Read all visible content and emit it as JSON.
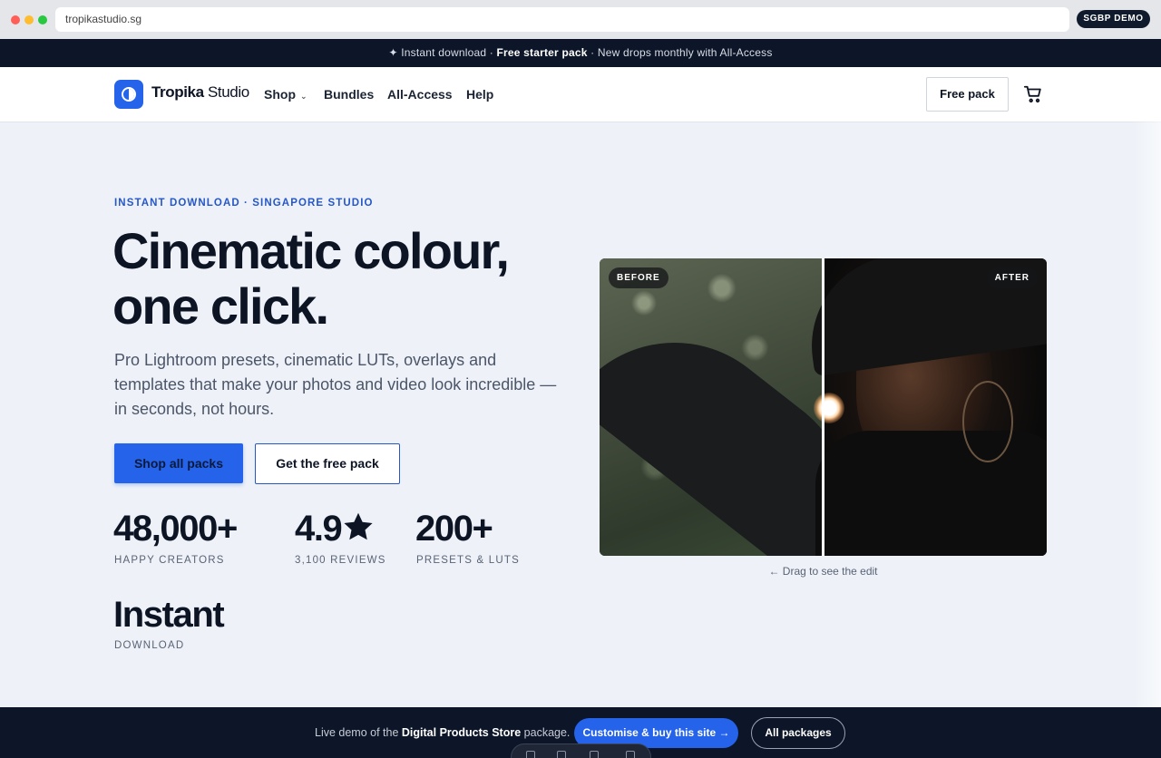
{
  "browser": {
    "url": "tropikastudio.sg",
    "badge": "SGBP DEMO"
  },
  "announcement": {
    "prefix": "✦ Instant download · ",
    "highlight": "Free starter pack",
    "suffix": " · New drops monthly with All-Access"
  },
  "header": {
    "brand_bold": "Tropika",
    "brand_rest": " Studio",
    "nav": {
      "shop": "Shop",
      "bundles": "Bundles",
      "all_access": "All-Access",
      "help": "Help"
    },
    "free_pack_label": "Free pack",
    "cart_icon": "cart-icon"
  },
  "hero": {
    "eyebrow": "INSTANT DOWNLOAD · SINGAPORE STUDIO",
    "title_line1": "Cinematic colour,",
    "title_line2": "one click.",
    "lede": "Pro Lightroom presets, cinematic LUTs, overlays and templates that make your photos and video look incredible — in seconds, not hours.",
    "primary_cta": "Shop all packs",
    "secondary_cta": "Get the free pack",
    "stats": [
      {
        "value": "48,000+",
        "label": "HAPPY CREATORS"
      },
      {
        "value": "4.9",
        "label": "3,100 REVIEWS"
      },
      {
        "value": "200+",
        "label": "PRESETS & LUTS"
      },
      {
        "value": "Instant",
        "label": "DOWNLOAD"
      }
    ]
  },
  "compare": {
    "before_label": "BEFORE",
    "after_label": "AFTER",
    "hint": "← Drag to see the edit"
  },
  "demo_bar": {
    "text_prefix": "Live demo of the ",
    "package_name": "Digital Products Store",
    "text_suffix": " package.",
    "customise_label": "Customise & buy this site →",
    "all_packages_label": "All packages"
  },
  "colors": {
    "accent": "#2563eb",
    "dark": "#0c1628",
    "page_bg": "#eef2f8"
  }
}
